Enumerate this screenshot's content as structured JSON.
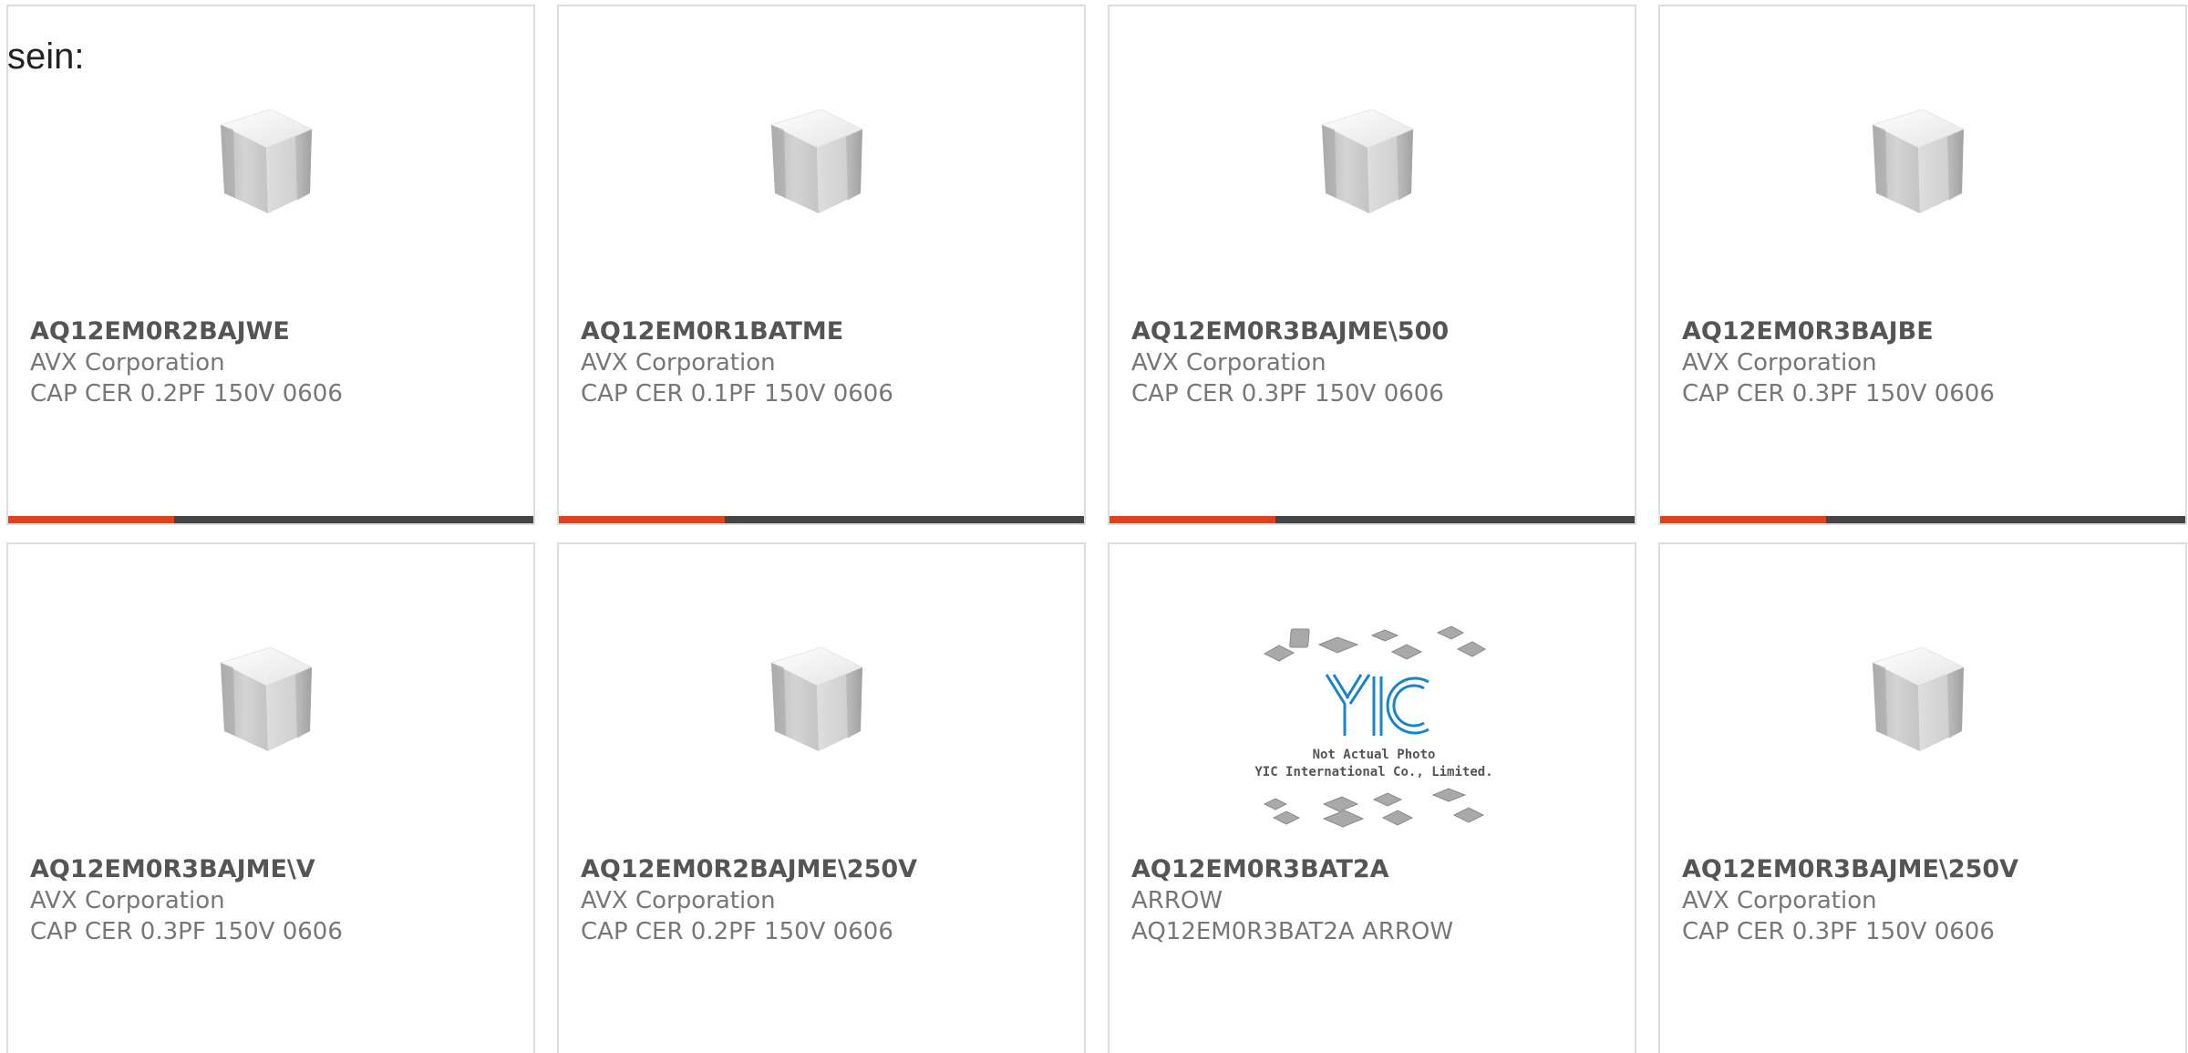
{
  "intro": {
    "text": "sein:"
  },
  "colors": {
    "accent": "#e0401a",
    "bar": "#444444",
    "border": "#dddddd"
  },
  "products": [
    {
      "part_no": "AQ12EM0R2BAJWE",
      "manufacturer": "AVX Corporation",
      "description": "CAP CER 0.2PF 150V 0606",
      "image": "ceramic-cube-icon"
    },
    {
      "part_no": "AQ12EM0R1BATME",
      "manufacturer": "AVX Corporation",
      "description": "CAP CER 0.1PF 150V 0606",
      "image": "ceramic-cube-icon"
    },
    {
      "part_no": "AQ12EM0R3BAJME\\500",
      "manufacturer": "AVX Corporation",
      "description": "CAP CER 0.3PF 150V 0606",
      "image": "ceramic-cube-icon"
    },
    {
      "part_no": "AQ12EM0R3BAJBE",
      "manufacturer": "AVX Corporation",
      "description": "CAP CER 0.3PF 150V 0606",
      "image": "ceramic-cube-icon"
    },
    {
      "part_no": "AQ12EM0R3BAJME\\V",
      "manufacturer": "AVX Corporation",
      "description": "CAP CER 0.3PF 150V 0606",
      "image": "ceramic-cube-icon"
    },
    {
      "part_no": "AQ12EM0R2BAJME\\250V",
      "manufacturer": "AVX Corporation",
      "description": "CAP CER 0.2PF 150V 0606",
      "image": "ceramic-cube-icon"
    },
    {
      "part_no": "AQ12EM0R3BAT2A",
      "manufacturer": "ARROW",
      "description": "AQ12EM0R3BAT2A ARROW",
      "image": "yic-placeholder-image",
      "placeholder_line1": "Not Actual Photo",
      "placeholder_line2": "YIC International Co., Limited.",
      "placeholder_logo": "YIC"
    },
    {
      "part_no": "AQ12EM0R3BAJME\\250V",
      "manufacturer": "AVX Corporation",
      "description": "CAP CER 0.3PF 150V 0606",
      "image": "ceramic-cube-icon"
    }
  ]
}
